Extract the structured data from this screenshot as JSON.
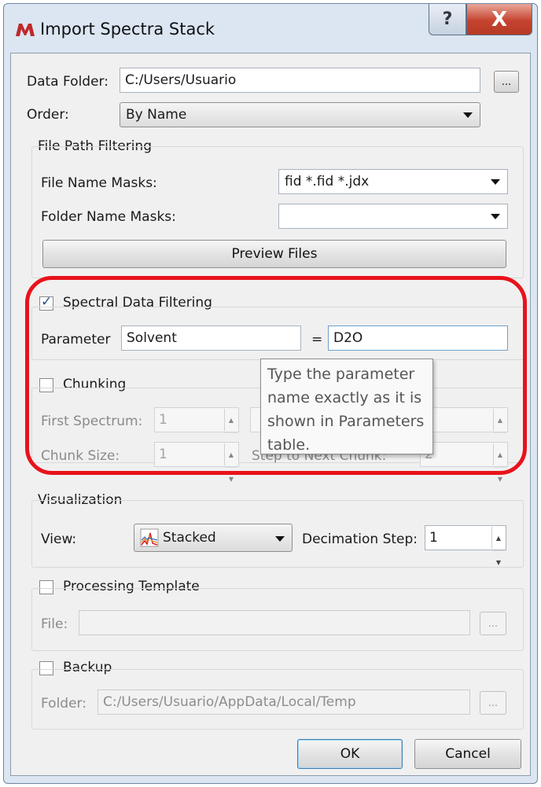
{
  "window": {
    "title": "Import Spectra Stack",
    "help_label": "?",
    "close_label": "X"
  },
  "data_folder": {
    "label": "Data Folder:",
    "value": "C:/Users/Usuario",
    "browse_label": "..."
  },
  "order": {
    "label": "Order:",
    "value": "By Name"
  },
  "file_path_filtering": {
    "title": "File Path Filtering",
    "file_name_masks": {
      "label": "File Name Masks:",
      "value": "fid *.fid *.jdx"
    },
    "folder_name_masks": {
      "label": "Folder Name Masks:",
      "value": ""
    },
    "preview_label": "Preview Files"
  },
  "spectral_data_filtering": {
    "title": "Spectral Data Filtering",
    "checked": true,
    "parameter_label": "Parameter",
    "parameter_value": "Solvent",
    "equals": "=",
    "value": "D2O"
  },
  "chunking": {
    "title": "Chunking",
    "checked": false,
    "first_spectrum_label": "First Spectrum:",
    "first_spectrum_value": "1",
    "chunk_size_label": "Chunk Size:",
    "chunk_size_value": "1",
    "step_label": "Step to Next Chunk:",
    "step_value": "2"
  },
  "tooltip": {
    "lines": [
      "Type the parameter",
      "name exactly as it is",
      "shown in Parameters",
      "table."
    ]
  },
  "visualization": {
    "title": "Visualization",
    "view_label": "View:",
    "view_value": "Stacked",
    "decimation_label": "Decimation Step:",
    "decimation_value": "1"
  },
  "processing_template": {
    "title": "Processing Template",
    "checked": false,
    "file_label": "File:",
    "file_value": "",
    "browse_label": "..."
  },
  "backup": {
    "title": "Backup",
    "checked": false,
    "folder_label": "Folder:",
    "folder_value": "C:/Users/Usuario/AppData/Local/Temp",
    "browse_label": "..."
  },
  "buttons": {
    "ok": "OK",
    "cancel": "Cancel"
  },
  "colors": {
    "highlight": "#e8121b",
    "close_button": "#c5442f",
    "window_frame": "#dbe6f2"
  }
}
